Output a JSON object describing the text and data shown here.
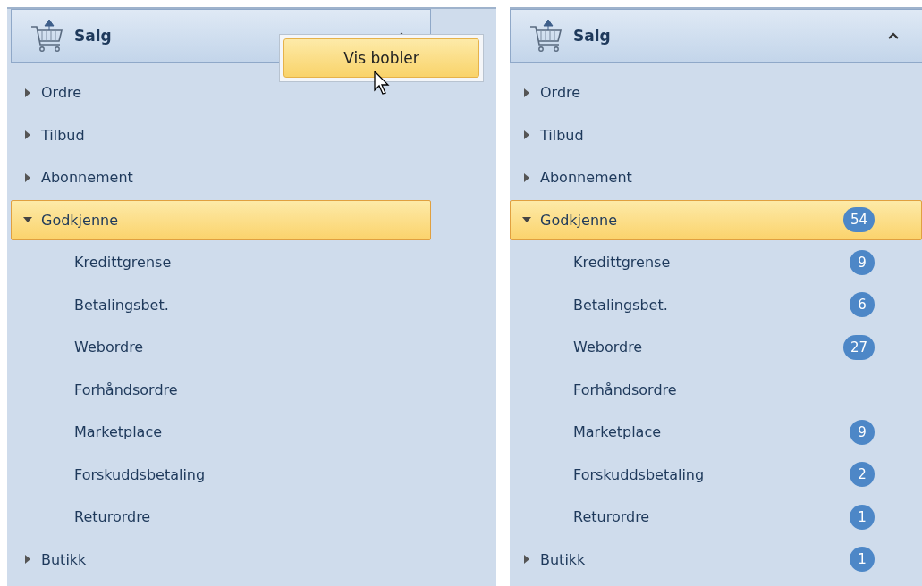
{
  "panels": [
    {
      "header": {
        "title": "Salg",
        "collapsible": true
      },
      "context_menu": {
        "item": "Vis bobler"
      },
      "items": [
        {
          "label": "Ordre",
          "expanded": false,
          "selected": false
        },
        {
          "label": "Tilbud",
          "expanded": false,
          "selected": false
        },
        {
          "label": "Abonnement",
          "expanded": false,
          "selected": false
        },
        {
          "label": "Godkjenne",
          "expanded": true,
          "selected": true,
          "children": [
            {
              "label": "Kredittgrense"
            },
            {
              "label": "Betalingsbet."
            },
            {
              "label": "Webordre"
            },
            {
              "label": "Forhåndsordre"
            },
            {
              "label": "Marketplace"
            },
            {
              "label": "Forskuddsbetaling"
            },
            {
              "label": "Returordre"
            }
          ]
        },
        {
          "label": "Butikk",
          "expanded": false,
          "selected": false
        }
      ]
    },
    {
      "header": {
        "title": "Salg",
        "collapsible": true
      },
      "items": [
        {
          "label": "Ordre",
          "expanded": false,
          "selected": false
        },
        {
          "label": "Tilbud",
          "expanded": false,
          "selected": false
        },
        {
          "label": "Abonnement",
          "expanded": false,
          "selected": false
        },
        {
          "label": "Godkjenne",
          "expanded": true,
          "selected": true,
          "badge": "54",
          "children": [
            {
              "label": "Kredittgrense",
              "badge": "9"
            },
            {
              "label": "Betalingsbet.",
              "badge": "6"
            },
            {
              "label": "Webordre",
              "badge": "27"
            },
            {
              "label": "Forhåndsordre"
            },
            {
              "label": "Marketplace",
              "badge": "9"
            },
            {
              "label": "Forskuddsbetaling",
              "badge": "2"
            },
            {
              "label": "Returordre",
              "badge": "1"
            }
          ]
        },
        {
          "label": "Butikk",
          "expanded": false,
          "selected": false,
          "badge": "1"
        }
      ]
    }
  ]
}
